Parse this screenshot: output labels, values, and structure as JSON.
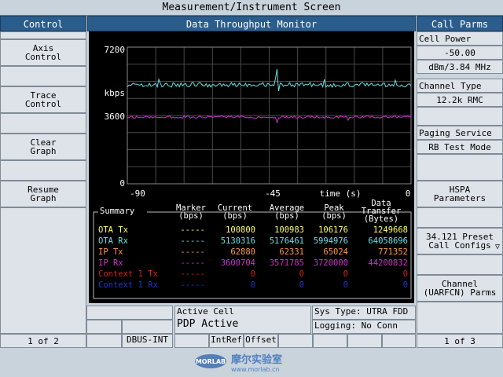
{
  "title": "Measurement/Instrument Screen",
  "left_panel": {
    "header": "Control",
    "buttons": [
      {
        "line1": "Axis",
        "line2": "Control"
      },
      {
        "line1": "Trace",
        "line2": "Control"
      },
      {
        "line1": "Clear",
        "line2": "Graph"
      },
      {
        "line1": "Resume",
        "line2": "Graph"
      }
    ],
    "page": "1 of 2"
  },
  "center": {
    "header": "Data Throughput Monitor",
    "y_ticks": [
      "7200",
      "3600",
      "0"
    ],
    "y_unit": "kbps",
    "x_ticks": [
      "-90",
      "-45",
      "0"
    ],
    "x_label": "time (s)",
    "summary": {
      "headers": {
        "summary": "Summary",
        "marker": [
          "Marker",
          "(bps)"
        ],
        "current": [
          "Current",
          "(bps)"
        ],
        "average": [
          "Average",
          "(bps)"
        ],
        "peak": [
          "Peak",
          "(bps)"
        ],
        "transfer": [
          "Data",
          "Transfer",
          "(Bytes)"
        ]
      },
      "rows": [
        {
          "label": "OTA Tx",
          "marker": "-----",
          "current": "100800",
          "average": "100983",
          "peak": "106176",
          "transfer": "1249668",
          "color": "#ffff66"
        },
        {
          "label": "OTA Rx",
          "marker": "-----",
          "current": "5130316",
          "average": "5176461",
          "peak": "5994976",
          "transfer": "64058696",
          "color": "#66e0e0"
        },
        {
          "label": "IP Tx",
          "marker": "-----",
          "current": "62880",
          "average": "62331",
          "peak": "65024",
          "transfer": "771352",
          "color": "#ff9944"
        },
        {
          "label": "IP Rx",
          "marker": "-----",
          "current": "3600704",
          "average": "3571785",
          "peak": "3720000",
          "transfer": "44200832",
          "color": "#cc33cc"
        },
        {
          "label": "Context 1 Tx",
          "marker": "-----",
          "current": "0",
          "average": "0",
          "peak": "0",
          "transfer": "0",
          "color": "#cc2222"
        },
        {
          "label": "Context 1 Rx",
          "marker": "-----",
          "current": "0",
          "average": "0",
          "peak": "0",
          "transfer": "0",
          "color": "#2233cc"
        }
      ]
    }
  },
  "right_panel": {
    "header": "Call Parms",
    "cell_power_label": "Cell Power",
    "cell_power_value": "-50.00",
    "cell_power_unit": "dBm/3.84 MHz",
    "channel_type_label": "Channel Type",
    "channel_type_value": "12.2k RMC",
    "paging_service_label": "Paging Service",
    "paging_service_value": "RB Test Mode",
    "hspa": {
      "line1": "HSPA",
      "line2": "Parameters"
    },
    "preset": {
      "line1": "34.121 Preset",
      "line2": "Call Configs",
      "arrow": "▽"
    },
    "channel": {
      "line1": "Channel",
      "line2": "(UARFCN) Parms"
    },
    "page": "1 of 3"
  },
  "status": {
    "active_cell_label": "Active Cell",
    "active_cell_value": "PDP Active",
    "sys_type": "Sys Type: UTRA FDD",
    "logging": "Logging: No Conn",
    "dbus": "DBUS-INT",
    "intref": "IntRef",
    "offset": "Offset"
  },
  "logo": {
    "brand": "MORLAB",
    "cn": "摩尔实验室",
    "url": "www.morlab.cn"
  },
  "colors": {
    "ota_rx_trace": "#66e0e0",
    "ip_rx_trace": "#cc33cc",
    "header_blue": "#2b5d8c"
  }
}
